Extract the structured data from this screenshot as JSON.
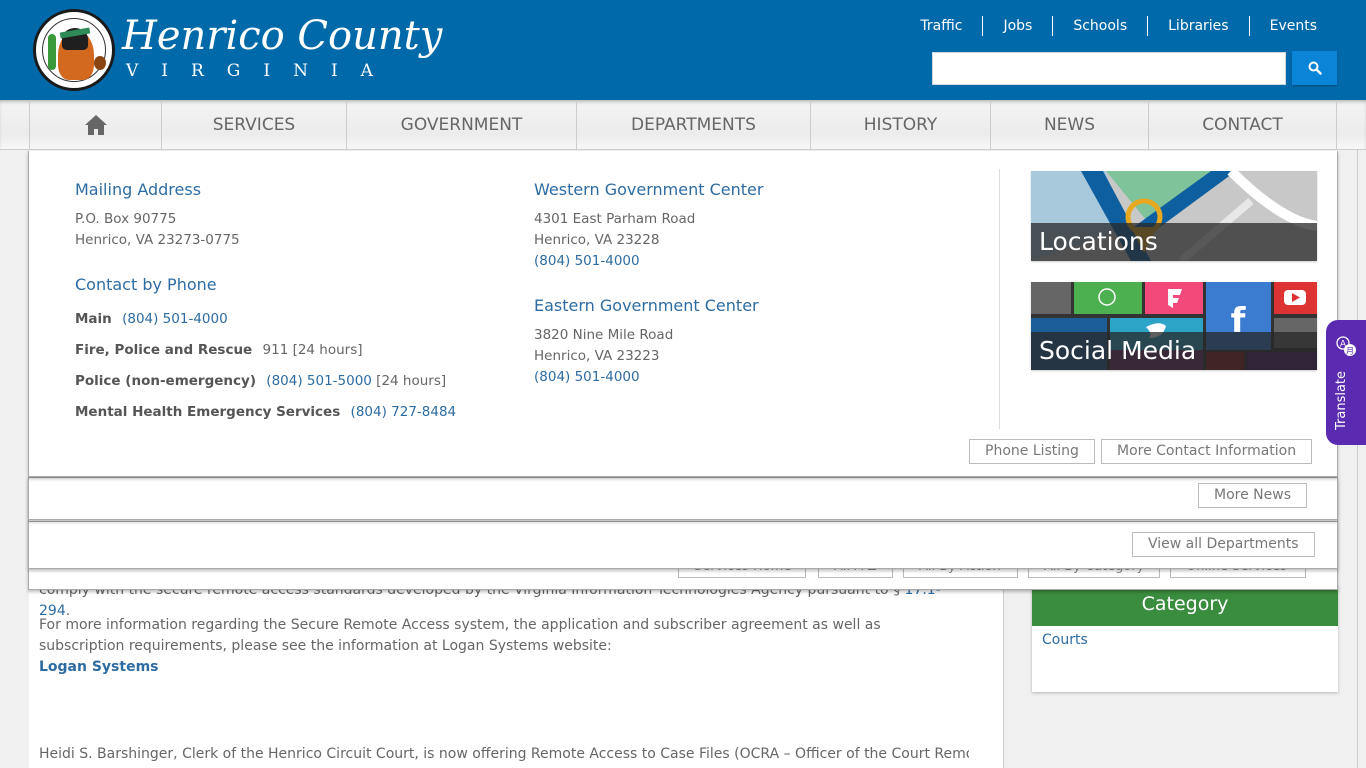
{
  "header": {
    "logo_title": "Henrico County",
    "logo_subtitle": "VIRGINIA",
    "top_links": [
      "Traffic",
      "Jobs",
      "Schools",
      "Libraries",
      "Events"
    ],
    "search": {
      "value": "",
      "placeholder": "",
      "icon": "search-icon"
    }
  },
  "nav": {
    "home_icon": "home-icon",
    "items": [
      "SERVICES",
      "GOVERNMENT",
      "DEPARTMENTS",
      "HISTORY",
      "NEWS",
      "CONTACT"
    ]
  },
  "contact_menu": {
    "mailing": {
      "title": "Mailing Address",
      "line1": "P.O. Box 90775",
      "line2": "Henrico, VA 23273-0775"
    },
    "phone": {
      "title": "Contact by Phone",
      "rows": [
        {
          "label": "Main",
          "link": "(804) 501-4000",
          "note": ""
        },
        {
          "label": "Fire, Police and Rescue",
          "link": "",
          "note": "911 [24 hours]"
        },
        {
          "label": "Police (non-emergency)",
          "link": "(804) 501-5000",
          "note": " [24 hours]"
        },
        {
          "label": "Mental Health Emergency Services",
          "link": "(804) 727-8484",
          "note": ""
        }
      ]
    },
    "western": {
      "title": "Western Government Center",
      "line1": "4301 East Parham Road",
      "line2": "Henrico, VA 23228",
      "phone": "(804) 501-4000"
    },
    "eastern": {
      "title": "Eastern Government Center",
      "line1": "3820 Nine Mile Road",
      "line2": "Henrico, VA 23223",
      "phone": "(804) 501-4000"
    },
    "tiles": [
      {
        "label": "Locations"
      },
      {
        "label": "Social Media"
      }
    ],
    "buttons": [
      "Phone Listing",
      "More Contact Information"
    ]
  },
  "news_menu": {
    "button": "More News"
  },
  "departments_menu": {
    "button": "View all Departments"
  },
  "services_menu": {
    "buttons": [
      "Services Home",
      "All A-Z",
      "All By Action",
      "All By Category",
      "Online Services"
    ]
  },
  "content": {
    "partial_line_before": "comply with the secure remote access standards developed by the Virginia Information Technologies Agency pursuant to § ",
    "partial_line_link": "17.1-294",
    "partial_line_after": ".",
    "paragraph1": "For more information regarding the Secure Remote Access system, the application and subscriber agreement as well as subscription requirements, please see the information at Logan Systems website:",
    "link1": "Logan Systems",
    "paragraph2": "Heidi S. Barshinger, Clerk of the Henrico Circuit Court, is now offering Remote Access to Case Files (OCRA – Officer of the Court Remote"
  },
  "sidebar": {
    "category_title": "Category",
    "category_items": [
      "Courts"
    ]
  },
  "translate": {
    "label": "Translate"
  }
}
